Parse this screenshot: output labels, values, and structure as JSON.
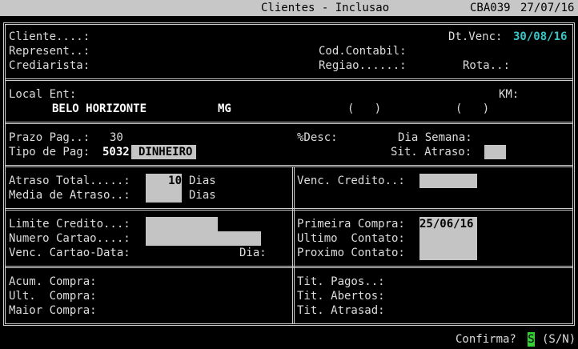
{
  "header": {
    "title": "Clientes - Inclusao",
    "code": "CBA039",
    "date": "27/07/16"
  },
  "sec1": {
    "cliente_label": "Cliente....:",
    "dtvenc_label": "Dt.Venc:",
    "dtvenc_value": "30/08/16",
    "represent_label": "Represent..:",
    "codcontabil_label": "Cod.Contabil:",
    "crediarista_label": "Crediarista:",
    "regiao_label": "Regiao......:",
    "rota_label": "Rota..:"
  },
  "sec2": {
    "localent_label": "Local Ent:",
    "km_label": "KM:",
    "city": "BELO HORIZONTE",
    "state": "MG",
    "paren1": "(   )",
    "paren2": "(   )"
  },
  "sec3": {
    "prazo_label": "Prazo Pag..:",
    "prazo_value": "30",
    "desc_label": "%Desc:",
    "diasemana_label": "Dia Semana:",
    "tipopag_label": "Tipo de Pag:",
    "tipopag_code": "5032",
    "tipopag_desc": "DINHEIRO",
    "sitatraso_label": "Sit. Atraso:"
  },
  "sec4": {
    "atrasototal_label": "Atraso Total.....:",
    "atrasototal_value": "10",
    "dias_label_1": "Dias",
    "mediaatraso_label": "Media de Atraso..:",
    "dias_label_2": "Dias",
    "venccredito_label": "Venc. Credito..:"
  },
  "sec5": {
    "limitecredito_label": "Limite Credito...:",
    "numerocartao_label": "Numero Cartao....:",
    "venccartao_label": "Venc. Cartao-Data:",
    "dia_label": "Dia:",
    "primeiracompra_label": "Primeira Compra:",
    "primeiracompra_value": "25/06/16",
    "ultimocontato_label": "Ultimo  Contato:",
    "proximocontato_label": "Proximo Contato:"
  },
  "sec6": {
    "acumcompra_label": "Acum. Compra:",
    "ultcompra_label": "Ult.  Compra:",
    "maiorcompra_label": "Maior Compra:",
    "titpagos_label": "Tit. Pagos..:",
    "titabertos_label": "Tit. Abertos:",
    "titatrasad_label": "Tit. Atrasad:"
  },
  "footer": {
    "confirma_label": "Confirma?",
    "answer": "S",
    "options": "(S/N)"
  }
}
